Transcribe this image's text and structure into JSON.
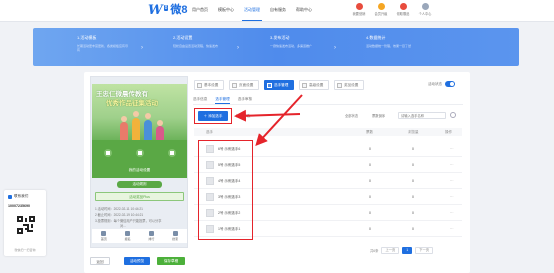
{
  "header": {
    "logo": {
      "mark": "W",
      "badge": "8",
      "name": "微8"
    },
    "nav": [
      "用户首页",
      "模板中心",
      "活动管理",
      "自有服务",
      "帮助中心"
    ],
    "nav_active_index": 2,
    "right": [
      {
        "label": "我要营销",
        "color": "#e84c3d"
      },
      {
        "label": "会员升级",
        "color": "#f5a623"
      },
      {
        "label": "领取赠品",
        "color": "#e84c3d"
      },
      {
        "label": "个人中心",
        "color": "#9aa7ba"
      }
    ]
  },
  "steps": [
    {
      "title": "1.活动模板",
      "desc": "长期活动更丰富更新，各类模板应有尽有"
    },
    {
      "title": "2.活动设置",
      "desc": "轻松自由设置活动流程，快速发布"
    },
    {
      "title": "3.发布活动",
      "desc": "一键快速发布活动，多渠道推广"
    },
    {
      "title": "4.数据统计",
      "desc": "活动数据统一管理，效果一目了然"
    }
  ],
  "preview": {
    "poster_line1": "王忠仁微晨传教有",
    "poster_line2": "优秀作品征集活动",
    "band_label": "我的活动设置",
    "rules_tab": "活动规则",
    "prize": "活动奖品Plus",
    "info": [
      "1.活动时间：2022-02-11 10:44:21",
      "2.截止时间：2022-02-19 10:44:21",
      "3.投票规则：每个微信用户只能投票，可以分享",
      "对..."
    ],
    "tabbar": [
      "首页",
      "报名",
      "排行",
      "搜索"
    ]
  },
  "bottom_buttons": [
    {
      "label": "返回",
      "style": "plain"
    },
    {
      "label": "活动预览",
      "style": "primary"
    },
    {
      "label": "保存草稿",
      "style": "success"
    }
  ],
  "chips": [
    {
      "label": "基本设置",
      "active": false
    },
    {
      "label": "页面设置",
      "active": false
    },
    {
      "label": "选手管理",
      "active": true
    },
    {
      "label": "高级设置",
      "active": false
    },
    {
      "label": "奖品设置",
      "active": false
    }
  ],
  "toggle_label": "活动状态",
  "toggle_on": true,
  "subtabs": [
    "选手信息",
    "选手管理",
    "选手审核"
  ],
  "subtab_active_index": 1,
  "toolbar": {
    "add": "＋ 添加选手",
    "batch": "批量修改",
    "sort": "全部状态",
    "filter": "票数倒序",
    "search_placeholder": "请输入选手名称"
  },
  "columns": [
    "选手",
    "票数",
    "浏览量",
    "操作"
  ],
  "rows": [
    {
      "name": "6号 示例选手6",
      "votes": "0",
      "views": "0",
      "op": "···"
    },
    {
      "name": "5号 示例选手5",
      "votes": "0",
      "views": "0",
      "op": "···"
    },
    {
      "name": "4号 示例选手4",
      "votes": "0",
      "views": "0",
      "op": "···"
    },
    {
      "name": "3号 示例选手3",
      "votes": "0",
      "views": "0",
      "op": "···"
    },
    {
      "name": "2号 示例选手2",
      "votes": "0",
      "views": "0",
      "op": "···"
    },
    {
      "name": "1号 示例选手1",
      "votes": "0",
      "views": "0",
      "op": "···"
    }
  ],
  "pager": {
    "total": "共6条",
    "prev": "上一页",
    "page": "1",
    "next": "下一页"
  },
  "contact": {
    "title": "联系我们",
    "phone": "10007235690",
    "caption": "微信扫一扫咨询"
  },
  "annotation_color": "#e5242b",
  "accent": "#1f6fe0"
}
